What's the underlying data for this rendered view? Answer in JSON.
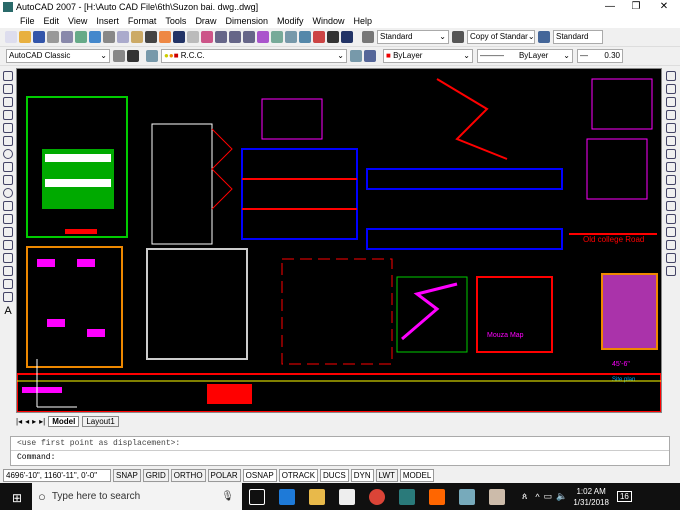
{
  "window": {
    "title": "AutoCAD 2007 - [H:\\Auto CAD File\\6th\\Suzon bai. dwg..dwg]",
    "minimize": "—",
    "maximize": "❐",
    "close": "✕"
  },
  "menu": [
    "File",
    "Edit",
    "View",
    "Insert",
    "Format",
    "Tools",
    "Draw",
    "Dimension",
    "Modify",
    "Window",
    "Help"
  ],
  "toolbar1": {
    "text_style": "Standard",
    "dim_style": "Copy of Standar",
    "table_style": "Standard"
  },
  "toolbar2": {
    "workspace": "AutoCAD Classic",
    "layer": "R.C.C.",
    "color": "ByLayer",
    "linetype": "ByLayer",
    "lineweight": "0.30"
  },
  "drawing": {
    "labels": {
      "road": "Old college Road",
      "mouza": "Mouza Map",
      "site": "Site plan",
      "dim": "45'-6\""
    }
  },
  "tabs": [
    "Model",
    "Layout1"
  ],
  "command": {
    "history": "<use first point as displacement>:",
    "prompt": "Command:"
  },
  "status": {
    "coords": "4696'-10\", 1160'-11\", 0'-0\"",
    "buttons": [
      "SNAP",
      "GRID",
      "ORTHO",
      "POLAR",
      "OSNAP",
      "OTRACK",
      "DUCS",
      "DYN",
      "LWT",
      "MODEL"
    ]
  },
  "taskbar": {
    "search_placeholder": "Type here to search",
    "time": "1:02 AM",
    "date": "1/31/2018",
    "notifications": "16"
  },
  "colors": {
    "magenta": "#ff00ff",
    "red": "#ff0000",
    "cyan": "#00ffff",
    "green": "#00c000",
    "yellow": "#ffff00",
    "blue": "#0000ff"
  }
}
